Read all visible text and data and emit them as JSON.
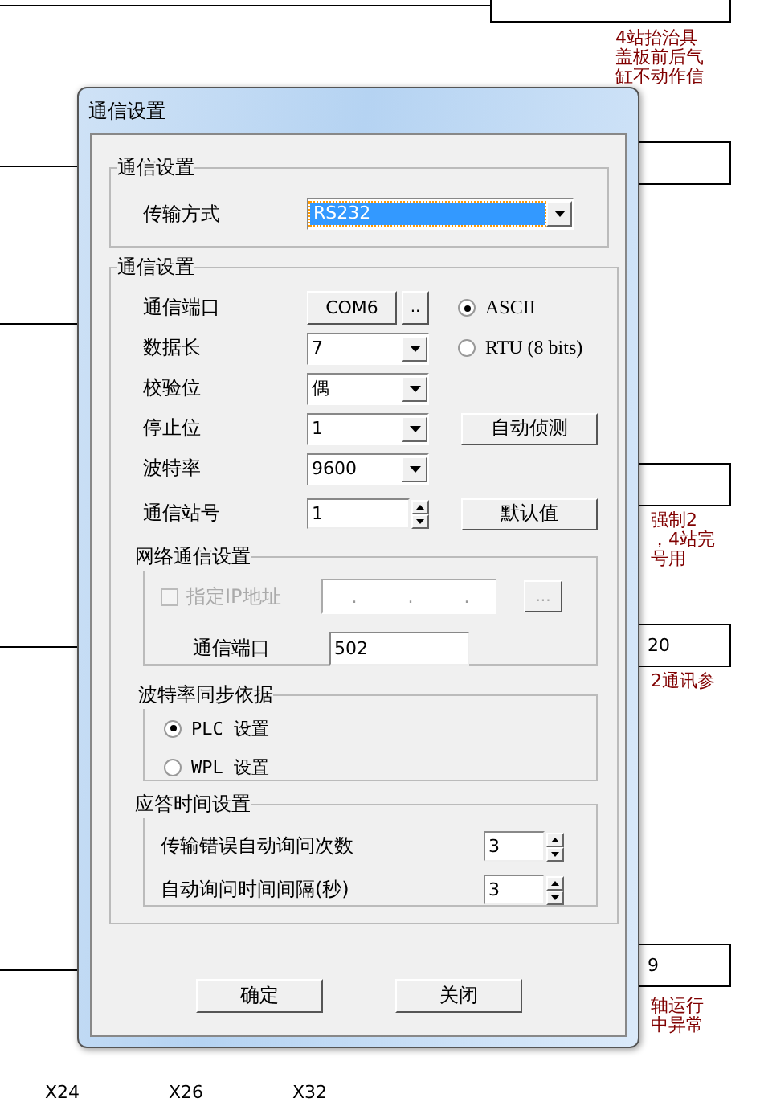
{
  "diagram": {
    "boxes": [
      {
        "kind": "empty"
      },
      {
        "kind": "empty"
      },
      {
        "kind": "empty"
      },
      {
        "kind": "text",
        "texts": [
          "20"
        ]
      },
      {
        "kind": "text",
        "texts": [
          "9"
        ]
      }
    ],
    "comments": [
      {
        "lines": [
          "4站抬治具",
          "盖板前后气",
          "缸不动作信"
        ]
      },
      {
        "lines": [
          "强制2",
          "，4站完",
          "号用"
        ]
      },
      {
        "lines": [
          "2通讯参"
        ]
      },
      {
        "lines": [
          "轴运行",
          "中异常"
        ]
      }
    ],
    "labels": [
      "X24",
      "X26",
      "X32"
    ]
  },
  "dialog": {
    "title": "通信设置",
    "transmission_group": {
      "title": "通信设置",
      "label": "传输方式",
      "value": "RS232"
    },
    "comm_group": {
      "title": "通信设置",
      "port": {
        "label": "通信端口",
        "value": "COM6",
        "browse": ".."
      },
      "fields": [
        {
          "label": "数据长",
          "value": "7",
          "kind": "dropdown"
        },
        {
          "label": "校验位",
          "value": "偶",
          "kind": "dropdown"
        },
        {
          "label": "停止位",
          "value": "1",
          "kind": "dropdown"
        },
        {
          "label": "波特率",
          "value": "9600",
          "kind": "dropdown"
        },
        {
          "label": "通信站号",
          "value": "1",
          "kind": "spinner"
        }
      ],
      "modes": [
        {
          "label": "ASCII",
          "selected": true
        },
        {
          "label": "RTU (8 bits)",
          "selected": false
        }
      ],
      "buttons": [
        "自动侦测",
        "默认值"
      ],
      "network": {
        "title": "网络通信设置",
        "ip": {
          "label": "指定IP地址",
          "checked": false,
          "disabled": true,
          "dots": [
            ".",
            ".",
            "."
          ],
          "browse": "..."
        },
        "port": {
          "label": "通信端口",
          "value": "502"
        }
      },
      "baud_sync": {
        "title": "波特率同步依据",
        "options": [
          {
            "label": "PLC 设置",
            "selected": true
          },
          {
            "label": "WPL 设置",
            "selected": false
          }
        ]
      },
      "response": {
        "title": "应答时间设置",
        "fields": [
          {
            "label": "传输错误自动询问次数",
            "value": "3"
          },
          {
            "label": "自动询问时间间隔(秒)",
            "value": "3"
          }
        ]
      }
    },
    "buttons": [
      "确定",
      "关闭"
    ]
  }
}
